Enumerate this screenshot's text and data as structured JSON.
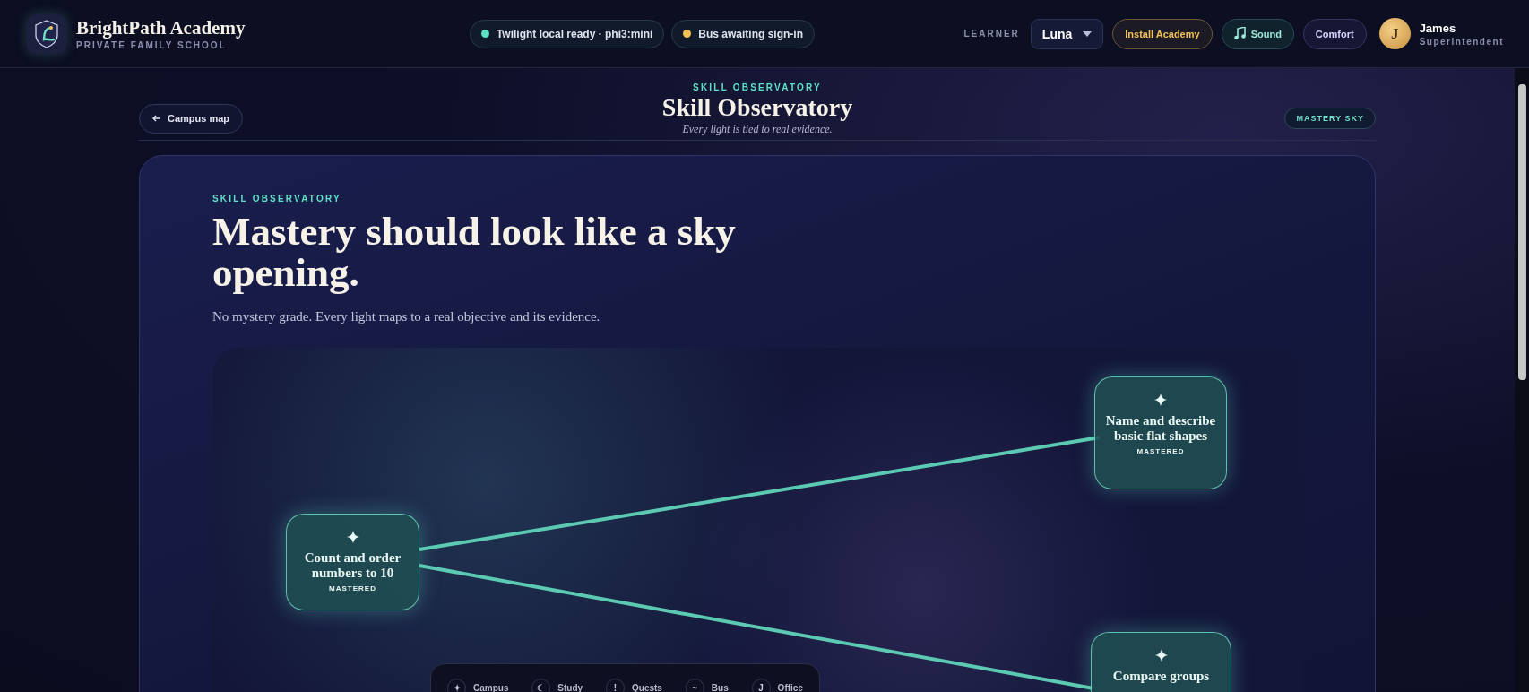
{
  "header": {
    "brand": {
      "name": "BrightPath Academy",
      "subtitle": "PRIVATE FAMILY SCHOOL"
    },
    "status_pills": [
      {
        "label": "Twilight local ready · phi3:mini",
        "color": "#5ee0c4"
      },
      {
        "label": "Bus awaiting sign-in",
        "color": "#f4c152"
      }
    ],
    "learner": {
      "label": "LEARNER",
      "value": "Luna"
    },
    "buttons": [
      {
        "label": "Install Academy",
        "kind": "install"
      },
      {
        "label": "Sound",
        "kind": "sound"
      },
      {
        "label": "Comfort",
        "kind": "comfort"
      }
    ],
    "user": {
      "initial": "J",
      "name": "James",
      "role": "Superintendent"
    }
  },
  "page_header": {
    "back_link": "Campus map",
    "eyebrow": "SKILL OBSERVATORY",
    "title": "Skill Observatory",
    "subtitle": "Every light is tied to real evidence.",
    "badge": "MASTERY SKY"
  },
  "hero": {
    "eyebrow": "SKILL OBSERVATORY",
    "title": "Mastery should look like a sky opening.",
    "description": "No mystery grade. Every light maps to a real objective and its evidence."
  },
  "skill_map": {
    "nodes": [
      {
        "title": "Count and order numbers to 10",
        "status": "MASTERED"
      },
      {
        "title": "Name and describe basic flat shapes",
        "status": "MASTERED"
      },
      {
        "title": "Compare groups"
      }
    ]
  },
  "dock": [
    {
      "icon": "✦",
      "label": "Campus"
    },
    {
      "icon": "☾",
      "label": "Study"
    },
    {
      "icon": "!",
      "label": "Quests"
    },
    {
      "icon": "~",
      "label": "Bus"
    },
    {
      "icon": "J",
      "label": "Office"
    }
  ]
}
